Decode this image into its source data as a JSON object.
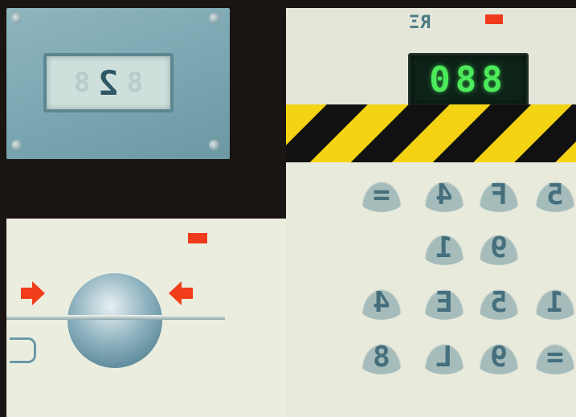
{
  "top_left_display": {
    "digit": "2",
    "ghost_digits": [
      "8",
      "8",
      "8"
    ]
  },
  "code_panel": {
    "label": "RΞ",
    "display_value": "088"
  },
  "keypad": {
    "keys": [
      {
        "label": "="
      },
      {
        "label": "4"
      },
      {
        "label": "F"
      },
      {
        "label": "5"
      },
      {
        "label": "1"
      },
      {
        "label": "9"
      },
      {
        "label": "4"
      },
      {
        "label": "E"
      },
      {
        "label": "5"
      },
      {
        "label": "1"
      },
      {
        "label": "8"
      },
      {
        "label": "L"
      },
      {
        "label": "9"
      },
      {
        "label": "="
      }
    ]
  },
  "colors": {
    "hazard_yellow": "#f3d312",
    "lcd_green": "#4cea5a",
    "indicator_red": "#f03a1c"
  }
}
